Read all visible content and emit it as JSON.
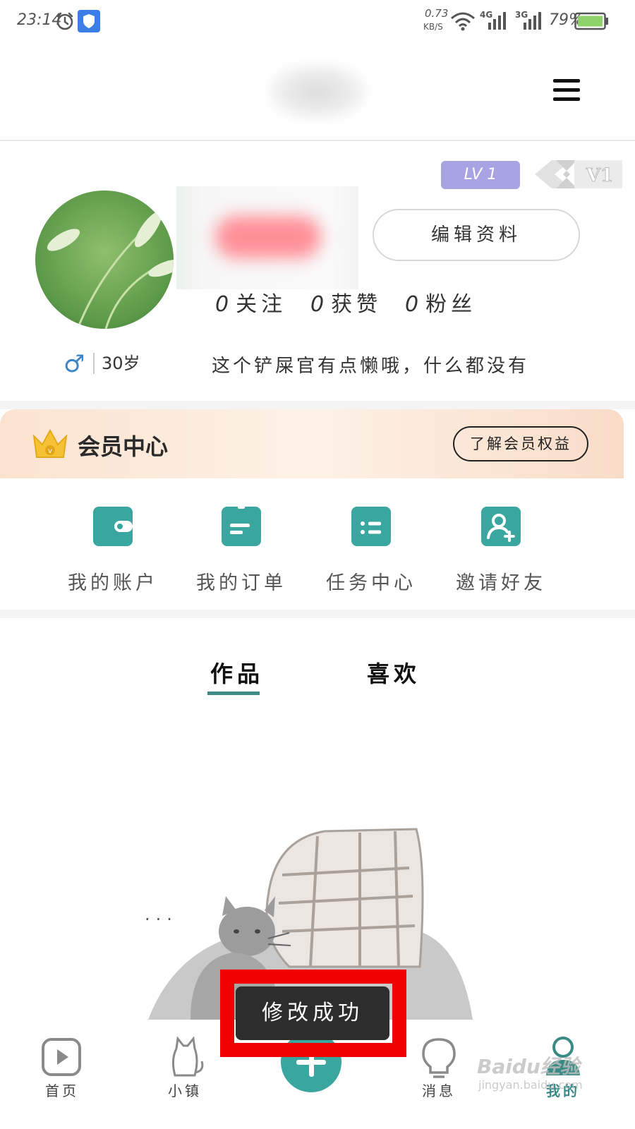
{
  "status_bar": {
    "time": "23:14",
    "network_speed_value": "0.73",
    "network_speed_unit": "KB/S",
    "signal_1": "4G",
    "signal_2": "3G",
    "battery": "79%",
    "icons": [
      "alarm-icon",
      "shield-icon",
      "wifi-icon",
      "signal-icon",
      "battery-icon"
    ]
  },
  "header": {
    "menu_icon": "hamburger-menu-icon"
  },
  "profile": {
    "level_badge": "LV 1",
    "vip_badge": "V1",
    "edit_button": "编辑资料",
    "stats": [
      {
        "count": "0",
        "label": "关注"
      },
      {
        "count": "0",
        "label": "获赞"
      },
      {
        "count": "0",
        "label": "粉丝"
      }
    ],
    "gender_symbol": "♂",
    "age": "30岁",
    "bio": "这个铲屎官有点懒哦，什么都没有"
  },
  "member": {
    "title": "会员中心",
    "link": "了解会员权益",
    "crown_icon": "crown-icon"
  },
  "services": [
    {
      "label": "我的账户",
      "icon": "wallet-icon"
    },
    {
      "label": "我的订单",
      "icon": "clipboard-icon"
    },
    {
      "label": "任务中心",
      "icon": "task-list-icon"
    },
    {
      "label": "邀请好友",
      "icon": "add-friend-icon"
    }
  ],
  "tabs": [
    {
      "label": "作品",
      "active": true
    },
    {
      "label": "喜欢",
      "active": false
    }
  ],
  "empty_state": {
    "dots": "..."
  },
  "toast": {
    "message": "修改成功"
  },
  "bottom_nav": [
    {
      "label": "首页",
      "icon": "play-icon"
    },
    {
      "label": "小镇",
      "icon": "cat-icon"
    },
    {
      "label": "",
      "icon": "plus-icon"
    },
    {
      "label": "消息",
      "icon": "bulb-icon"
    },
    {
      "label": "我的",
      "icon": "user-icon",
      "active": true
    }
  ],
  "watermark": {
    "text": "Baidu经验",
    "sub": "jingyan.baidu.com"
  },
  "colors": {
    "accent": "#3aa6a0",
    "accent_dark": "#3a8a86",
    "level_badge": "#a8a3e3",
    "toast_bg": "#2d2d2d",
    "highlight": "#f00000"
  }
}
